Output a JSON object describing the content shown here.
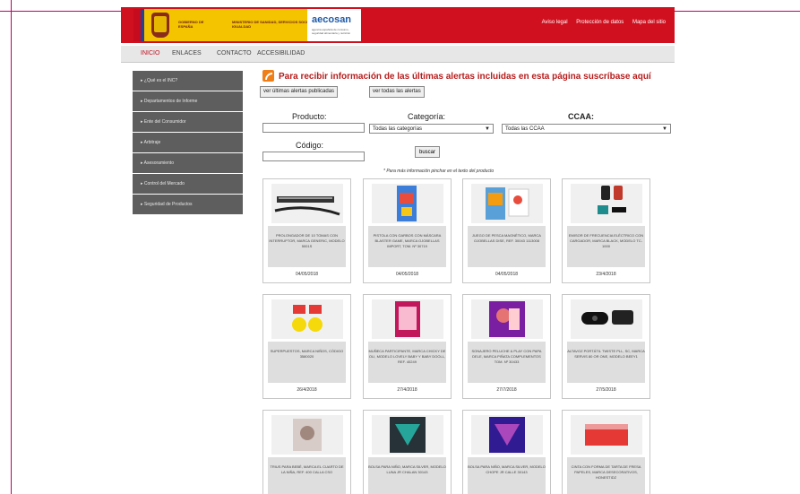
{
  "header": {
    "gov_text_1": "GOBIERNO DE ESPAÑA",
    "gov_text_2": "MINISTERIO DE SANIDAD, SERVICIOS SOCIALES E IGUALDAD",
    "brand": "aecosan",
    "brand_sub": "agencia española de consumo, seguridad alimentaria y nutrición",
    "links": [
      "Aviso legal",
      "Protección de datos",
      "Mapa del sitio"
    ]
  },
  "nav": {
    "items": [
      "INICIO",
      "ENLACES",
      "CONTACTO",
      "ACCESIBILIDAD"
    ]
  },
  "sidebar": {
    "items": [
      "¿Qué es el INC?",
      "Departamentos de Informe",
      "Ente del Consumidor",
      "Arbitraje",
      "Asesoramiento",
      "Control del Mercado",
      "Seguridad de Productos"
    ]
  },
  "main": {
    "alert_title": "Para recibir información de las últimas alertas incluidas en esta página suscríbase aquí",
    "btn_last": "ver últimas alertas publicadas",
    "btn_all": "ver todas las alertas",
    "label_product": "Producto:",
    "label_category": "Categoría:",
    "label_ccaa": "CCAA:",
    "label_code": "Código:",
    "select_category": "Todas las categorías",
    "select_ccaa": "Todas las CCAA",
    "search_btn": "buscar",
    "note": "* Para más información pinchar en el texto del producto"
  },
  "cards": [
    {
      "desc": "PROLONGADOR DE 10 TOMAS CON INTERRUPTOR, MARCA GENERIC, MODELO 5001S",
      "date": "04/05/2018",
      "image": "power-strip"
    },
    {
      "desc": "PISTOLA CON GARBOS CON MÁSCARA BLASTER GAME, MARCA OJOBELLAS IMPORT, TOM. Nº 30719",
      "date": "04/05/2018",
      "image": "toy-blaster"
    },
    {
      "desc": "JUEGO DE PESCA MAGNÉTICO, MARCA OJOBELLAS DISE, REF. 30043 1113008",
      "date": "04/05/2018",
      "image": "fishing-game"
    },
    {
      "desc": "EMISOR DE FRECUENCIA ELÉCTRICO CON CARGADOR, MARCA BLACK, MODELO TC-1000",
      "date": "23/4/2018",
      "image": "charger"
    },
    {
      "desc": "SUPERPUESTOS, MARCA NIÑOS, CÓDIGO 3580020",
      "date": "26/4/2018",
      "image": "yellow-red-toy"
    },
    {
      "desc": "MUÑECA PARTICIPANTE, MARCA CHICKY DE OLI, MODELO LOVELY BABY Y BABY DOOLL, REF. 40249",
      "date": "27/4/2018",
      "image": "doll-box"
    },
    {
      "desc": "SONAJERO PELUCHE & PLAY CON PAPA DELE, MARCA PIÑATA COMPLEMENTOS TOM. Nº 30433",
      "date": "27/7/2018",
      "image": "plush-toy"
    },
    {
      "desc": "ALTAVOZ PORTÁTIL TWISTE PLL, SC, MARCA SERVIS 80 OR ONE, MODELO BEEY1",
      "date": "27/5/2018",
      "image": "speaker"
    },
    {
      "desc": "TRIUS PARA BEBÉ, MARCA EL CUARTO DE LA NIÑA, REF. 400 CALLA CSO",
      "date": "",
      "image": "baby-item"
    },
    {
      "desc": "BOLSA PARA NIÑO, MARCA SILVER, MODELO LUNA JR CHALAN 30143",
      "date": "",
      "image": "bag"
    },
    {
      "desc": "BOLSA PARA NIÑO, MARCA SILVER, MODELO CHOPE JR CALLE 30143",
      "date": "",
      "image": "bag-purple"
    },
    {
      "desc": "CINTA CON FORMA DE TARTA DE FRESA PAPELES, MARCA DESECORATIVOS, HONESTIDZ",
      "date": "",
      "image": "cake-box"
    }
  ]
}
